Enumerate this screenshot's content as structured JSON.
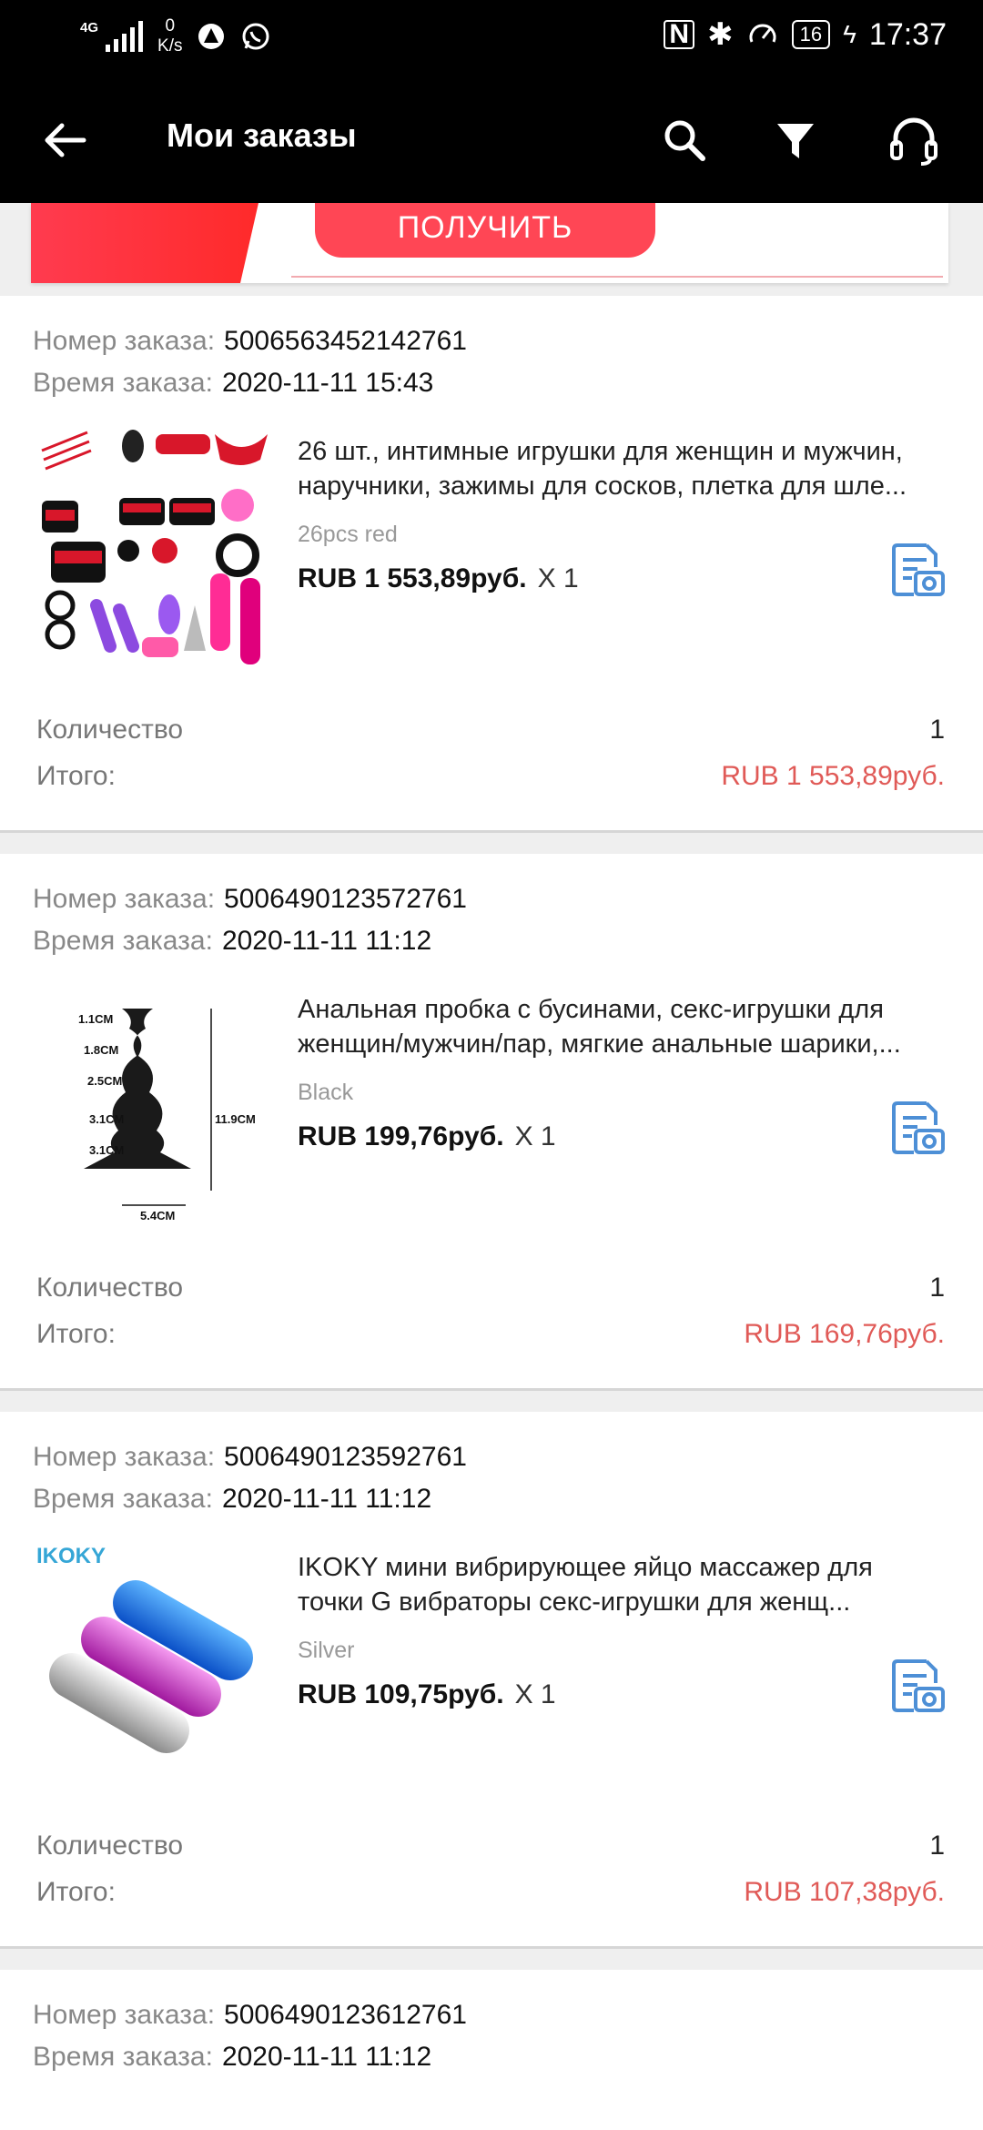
{
  "status_bar": {
    "network": "4G",
    "speed_value": "0",
    "speed_unit": "K/s",
    "battery": "16",
    "time": "17:37"
  },
  "appbar": {
    "title": "Мои заказы",
    "icons": [
      "back-arrow-icon",
      "search-icon",
      "filter-icon",
      "headset-icon"
    ]
  },
  "promo": {
    "button_label": "ПОЛУЧИТЬ"
  },
  "labels": {
    "order_number": "Номер заказа:",
    "order_time": "Время заказа:",
    "quantity": "Количество",
    "total": "Итого:"
  },
  "orders": [
    {
      "number": "5006563452142761",
      "time": "2020-11-11 15:43",
      "product": "26 шт., интимные игрушки для женщин и мужчин, наручники, зажимы для сосков, плетка для шле...",
      "variant": "26pcs red",
      "price": "RUB 1 553,89руб.",
      "qty_mult": "X 1",
      "quantity": "1",
      "total": "RUB 1 553,89руб."
    },
    {
      "number": "5006490123572761",
      "time": "2020-11-11 11:12",
      "product": "Анальная пробка с бусинами, секс-игрушки для женщин/мужчин/пар, мягкие анальные шарики,...",
      "variant": "Black",
      "price": "RUB 199,76руб.",
      "qty_mult": "X 1",
      "quantity": "1",
      "total": "RUB 169,76руб.",
      "image_labels": [
        "1.1CM",
        "1.8CM",
        "2.5CM",
        "3.1CM",
        "3.1CM",
        "11.9CM",
        "5.4CM"
      ]
    },
    {
      "number": "5006490123592761",
      "time": "2020-11-11 11:12",
      "product": "IKOKY мини вибрирующее яйцо массажер для точки G вибраторы секс-игрушки для женщ...",
      "variant": "Silver",
      "price": "RUB 109,75руб.",
      "qty_mult": "X 1",
      "quantity": "1",
      "total": "RUB 107,38руб.",
      "image_brand": "IKOKY"
    },
    {
      "number": "5006490123612761",
      "time": "2020-11-11 11:12"
    }
  ]
}
